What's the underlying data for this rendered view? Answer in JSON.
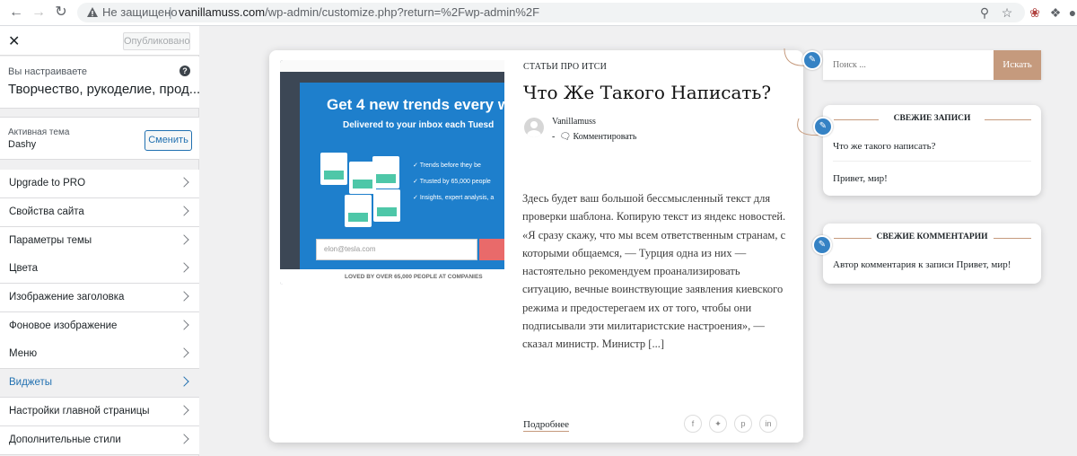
{
  "browser": {
    "security_text": "Не защищено",
    "separator": "|",
    "url_host": "vanillamuss.com",
    "url_path": "/wp-admin/customize.php?return=%2Fwp-admin%2F"
  },
  "customizer": {
    "publish_label": "Опубликовано",
    "customizing_label": "Вы настраиваете",
    "site_title": "Творчество, рукоделие, прод...",
    "active_theme_label": "Активная тема",
    "theme_name": "Dashy",
    "change_label": "Сменить",
    "menu": [
      {
        "label": "Upgrade to PRO"
      },
      {
        "label": "Свойства сайта"
      },
      {
        "label": "Параметры темы"
      },
      {
        "label": "Цвета"
      },
      {
        "label": "Изображение заголовка"
      },
      {
        "label": "Фоновое изображение"
      },
      {
        "label": "Меню"
      },
      {
        "label": "Виджеты",
        "active": true
      },
      {
        "label": "Настройки главной страницы"
      },
      {
        "label": "Дополнительные стили"
      }
    ]
  },
  "ad": {
    "headline": "Get 4 new trends every w",
    "subline": "Delivered to your inbox each Tuesd",
    "checks": [
      "Trends before they be",
      "Trusted by 65,000 people",
      "Insights, expert analysis, a"
    ],
    "email_placeholder": "elon@tesla.com",
    "footer": "LOVED BY OVER 65,000 PEOPLE AT COMPANIES"
  },
  "post": {
    "category": "СТАТЬИ ПРО ИТСИ",
    "title": "Что Же Такого Написать?",
    "author": "Vanillamuss",
    "meta_dash": "-",
    "comment_label": "Комментировать",
    "excerpt": "Здесь будет ваш большой бессмысленный текст для проверки шаблона. Копирую текст из яндекс новостей. «Я сразу скажу, что мы всем ответственным странам, с которыми общаемся, — Турция одна из них — настоятельно рекомендуем проанализировать ситуацию, вечные воинствующие заявления киевского режима и предостерегаем их от того, чтобы они подписывали эти милитаристские настроения», — сказал министр. Министр [...]",
    "read_more": "Подробнее"
  },
  "sidebar": {
    "search_placeholder": "Поиск ...",
    "search_button": "Искать",
    "recent_posts_title": "СВЕЖИЕ ЗАПИСИ",
    "recent_posts": [
      "Что же такого написать?",
      "Привет, мир!"
    ],
    "recent_comments_title": "СВЕЖИЕ КОММЕНТАРИИ",
    "recent_comment": "Автор комментария к записи Привет, мир!"
  },
  "colors": {
    "accent": "#c59a7d",
    "wp_blue": "#2271b1",
    "edit_blue": "#3582c4"
  }
}
